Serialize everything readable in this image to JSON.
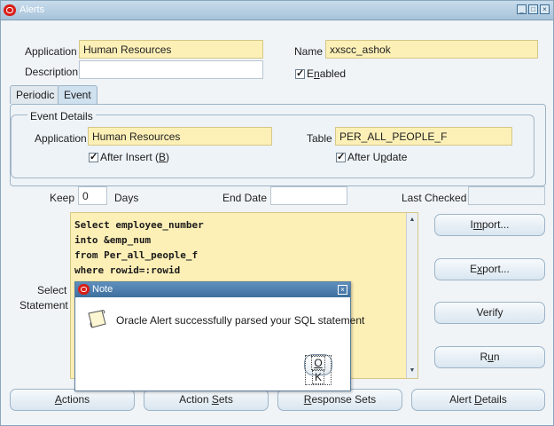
{
  "window": {
    "title": "Alerts",
    "min": "_",
    "restore": "□",
    "close": "×"
  },
  "header": {
    "application_label": "Application",
    "application_value": "Human Resources",
    "description_label": "Description",
    "description_value": "",
    "name_label": "Name",
    "name_value": "xxscc_ashok",
    "enabled_label_pre": "E",
    "enabled_label_u": "n",
    "enabled_label_post": "abled"
  },
  "tabs": [
    {
      "label": "Periodic"
    },
    {
      "label": "Event"
    }
  ],
  "event_details": {
    "group_title": "Event Details",
    "application_label": "Application",
    "application_value": "Human Resources",
    "table_label": "Table",
    "table_value": "PER_ALL_PEOPLE_F",
    "after_insert_pre": "After Insert (",
    "after_insert_u": "B",
    "after_insert_post": ")",
    "after_update_pre": "After U",
    "after_update_u": "p",
    "after_update_post": "date"
  },
  "schedule": {
    "keep_label": "Keep",
    "keep_value": "0",
    "days_label": "Days",
    "end_date_label": "End Date",
    "end_date_value": "",
    "last_checked_label": "Last Checked",
    "last_checked_value": ""
  },
  "statement": {
    "label_line1": "Select",
    "label_line2": "Statement",
    "lines": [
      "Select employee_number",
      "into &emp_num",
      "from Per_all_people_f",
      "where rowid=:rowid"
    ]
  },
  "side_buttons": {
    "import_pre": "I",
    "import_u": "m",
    "import_post": "port...",
    "export_pre": "E",
    "export_u": "x",
    "export_post": "port...",
    "verify": "Verify",
    "run_pre": "R",
    "run_u": "u",
    "run_post": "n"
  },
  "bottom_buttons": {
    "actions_u": "A",
    "actions_post": "ctions",
    "action_sets_pre": "Action ",
    "action_sets_u": "S",
    "action_sets_post": "ets",
    "response_sets_u": "R",
    "response_sets_post": "esponse Sets",
    "alert_details_pre": "Alert ",
    "alert_details_u": "D",
    "alert_details_post": "etails"
  },
  "dialog": {
    "title": "Note",
    "close": "×",
    "message": "Oracle Alert successfully parsed your SQL statement",
    "ok_u": "O",
    "ok_post": "K"
  },
  "colors": {
    "required_field": "#fdf0b7",
    "title_bar": "#a7c3da",
    "dialog_title": "#3d6f9e"
  }
}
